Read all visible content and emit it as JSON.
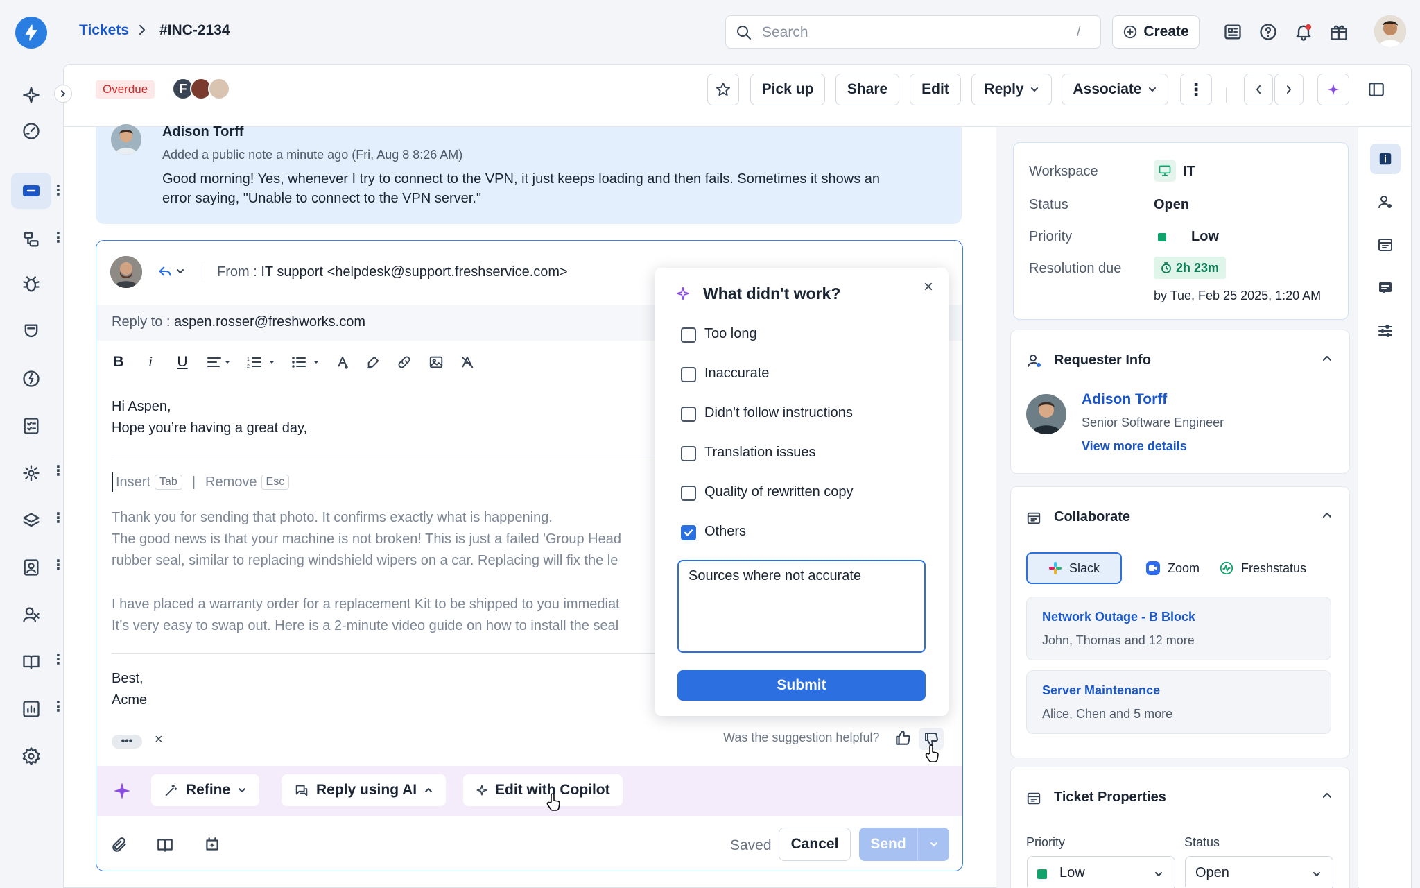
{
  "breadcrumb": {
    "root": "Tickets",
    "current": "#INC-2134"
  },
  "search": {
    "placeholder": "Search",
    "shortcut": "/"
  },
  "topbar": {
    "create_label": "Create"
  },
  "ticket_header": {
    "badge": "Overdue",
    "avatar_initial": "F",
    "actions": {
      "pick_up": "Pick up",
      "share": "Share",
      "edit": "Edit",
      "reply": "Reply",
      "associate": "Associate"
    }
  },
  "note": {
    "author": "Adison Torff",
    "meta": "Added a public note a minute ago (Fri, Aug 8 8:26 AM)",
    "body_line1": "Good morning! Yes, whenever I try to connect to the VPN, it just keeps loading and then fails. Sometimes it shows an",
    "body_line2": "error saying, \"Unable to connect to the VPN server.\""
  },
  "compose": {
    "from_label": "From :",
    "from_value": "IT support <helpdesk@support.freshservice.com>",
    "reply_to_label": "Reply to :",
    "reply_to_value": "aspen.rosser@freshworks.com",
    "greeting1": "Hi Aspen,",
    "greeting2": "Hope you’re having a great day,",
    "insert_label": "Insert",
    "insert_key": "Tab",
    "remove_label": "Remove",
    "remove_key": "Esc",
    "suggestion": [
      "Thank you for sending that photo. It confirms exactly what is happening.",
      "The good news is that your machine is not broken! This is just a failed 'Group Head",
      "rubber seal, similar to replacing windshield wipers on a car. Replacing will fix the le",
      "I have placed a warranty order for a replacement Kit to be shipped to you immediat",
      "It’s very easy to swap out. Here is a 2-minute video guide on how to install the seal"
    ],
    "signoff1": "Best,",
    "signoff2": "Acme",
    "helpful_question": "Was the suggestion helpful?",
    "saved": "Saved",
    "cancel": "Cancel",
    "send": "Send"
  },
  "feedback": {
    "title": "What didn't work?",
    "options": [
      {
        "label": "Too long",
        "checked": false
      },
      {
        "label": "Inaccurate",
        "checked": false
      },
      {
        "label": "Didn't follow instructions",
        "checked": false
      },
      {
        "label": "Translation issues",
        "checked": false
      },
      {
        "label": "Quality of rewritten copy",
        "checked": false
      },
      {
        "label": "Others",
        "checked": true
      }
    ],
    "comment": "Sources where not accurate",
    "submit": "Submit"
  },
  "ai_bar": {
    "refine": "Refine",
    "reply_ai": "Reply using AI",
    "edit_copilot": "Edit with Copilot"
  },
  "summary": {
    "workspace_label": "Workspace",
    "workspace_value": "IT",
    "status_label": "Status",
    "status_value": "Open",
    "priority_label": "Priority",
    "priority_value": "Low",
    "resolution_label": "Resolution due",
    "resolution_timer": "2h 23m",
    "resolution_date": "by Tue, Feb 25 2025, 1:20 AM"
  },
  "requester": {
    "title": "Requester Info",
    "name": "Adison Torff",
    "role": "Senior Software Engineer",
    "link": "View more details"
  },
  "collaborate": {
    "title": "Collaborate",
    "tabs": [
      "Slack",
      "Zoom",
      "Freshstatus"
    ],
    "channels": [
      {
        "name": "Network Outage - B Block",
        "members": "John, Thomas and 12 more"
      },
      {
        "name": "Server Maintenance",
        "members": "Alice, Chen and 5 more"
      }
    ]
  },
  "properties": {
    "title": "Ticket Properties",
    "priority_label": "Priority",
    "priority_value": "Low",
    "status_label": "Status",
    "status_value": "Open"
  },
  "colors": {
    "primary": "#2b6fe0",
    "link": "#1a56c7",
    "overdue": "#cf2a2a",
    "ai_purple": "#8a4fe0",
    "low_green": "#10a36b"
  }
}
